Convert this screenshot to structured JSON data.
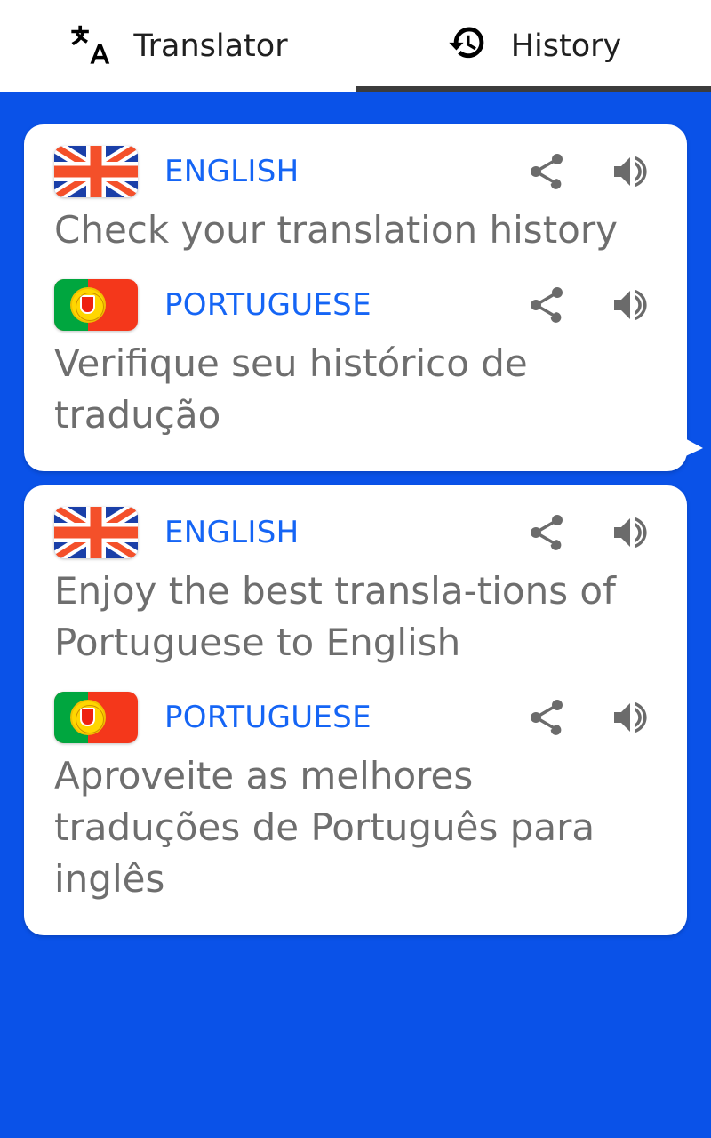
{
  "tabs": [
    {
      "label": "Translator",
      "icon": "translate-icon",
      "active": false
    },
    {
      "label": "History",
      "icon": "history-clock-icon",
      "active": true
    }
  ],
  "colors": {
    "background_blue": "#0a52e8",
    "language_label_blue": "#1565f5",
    "body_text_gray": "#6e6e6e",
    "icon_gray": "#6b6b6b",
    "tab_indicator": "#3c3c3c",
    "card_white": "#ffffff"
  },
  "actions": {
    "share_label": "share-icon",
    "speak_label": "volume-icon"
  },
  "history": [
    {
      "source": {
        "language": "ENGLISH",
        "flag": "uk-flag",
        "text": "Check your translation history"
      },
      "target": {
        "language": "PORTUGUESE",
        "flag": "portugal-flag",
        "text": "Verifique seu histórico de tradução"
      }
    },
    {
      "source": {
        "language": "ENGLISH",
        "flag": "uk-flag",
        "text": "Enjoy the best transla-tions of Portuguese to English"
      },
      "target": {
        "language": "PORTUGUESE",
        "flag": "portugal-flag",
        "text": "Aproveite as melhores traduções de Português para inglês"
      }
    }
  ]
}
